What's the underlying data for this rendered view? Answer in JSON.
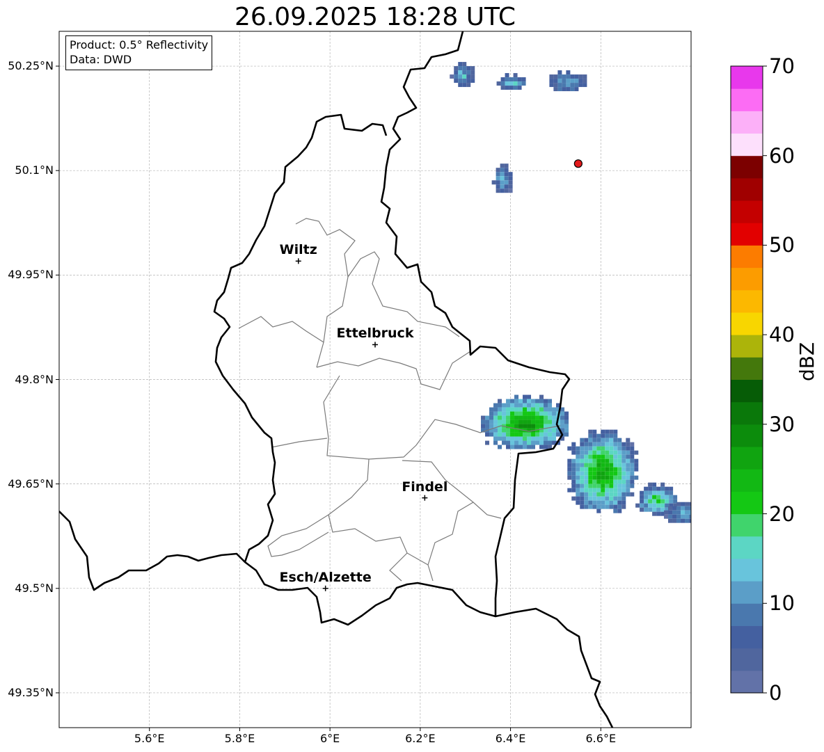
{
  "title": "26.09.2025 18:28 UTC",
  "info": {
    "product": "Product: 0.5° Reflectivity",
    "data": "Data: DWD"
  },
  "lat_ticks": [
    "50.25°N",
    "50.1°N",
    "49.95°N",
    "49.8°N",
    "49.65°N",
    "49.5°N",
    "49.35°N"
  ],
  "lon_ticks": [
    "5.6°E",
    "5.8°E",
    "6°E",
    "6.2°E",
    "6.4°E",
    "6.6°E"
  ],
  "cities": [
    {
      "name": "Wiltz",
      "lat": 49.97,
      "lon": 5.93
    },
    {
      "name": "Ettelbruck",
      "lat": 49.85,
      "lon": 6.1
    },
    {
      "name": "Findel",
      "lat": 49.63,
      "lon": 6.21
    },
    {
      "name": "Esch/Alzette",
      "lat": 49.5,
      "lon": 5.99
    }
  ],
  "marker": {
    "lat": 50.11,
    "lon": 6.55,
    "color": "#e31a1c"
  },
  "colorbar": {
    "label": "dBZ",
    "tick_labels": [
      "0",
      "10",
      "20",
      "30",
      "40",
      "50",
      "60",
      "70"
    ],
    "colors": [
      "#6272a8",
      "#50669e",
      "#4460a0",
      "#4a78ae",
      "#5b9ec8",
      "#68c4dc",
      "#5cd6c4",
      "#40d46c",
      "#14c814",
      "#12b814",
      "#10a410",
      "#0c8c0c",
      "#0a780a",
      "#065c06",
      "#44780c",
      "#acb40a",
      "#f8d600",
      "#fcb800",
      "#fc9c00",
      "#fc7c00",
      "#e20000",
      "#c40000",
      "#a00000",
      "#7c0000",
      "#fde0fc",
      "#fcb0f8",
      "#fc6cf4",
      "#e838ec"
    ]
  },
  "chart_data": {
    "type": "heatmap",
    "title": "26.09.2025 18:28 UTC",
    "xlabel": "",
    "ylabel": "",
    "xlim": [
      5.4,
      6.8
    ],
    "ylim": [
      49.3,
      50.3
    ],
    "value_range": [
      0,
      70
    ],
    "unit": "dBZ",
    "echo_cells": [
      {
        "lon": 6.43,
        "lat": 49.74,
        "max_dbz": 30
      },
      {
        "lon": 6.6,
        "lat": 49.67,
        "max_dbz": 28
      },
      {
        "lon": 6.72,
        "lat": 49.63,
        "max_dbz": 22
      },
      {
        "lon": 6.78,
        "lat": 49.61,
        "max_dbz": 15
      },
      {
        "lon": 6.38,
        "lat": 50.09,
        "max_dbz": 15
      },
      {
        "lon": 6.29,
        "lat": 50.24,
        "max_dbz": 15
      },
      {
        "lon": 6.4,
        "lat": 50.23,
        "max_dbz": 17
      },
      {
        "lon": 6.52,
        "lat": 50.23,
        "max_dbz": 14
      }
    ]
  }
}
